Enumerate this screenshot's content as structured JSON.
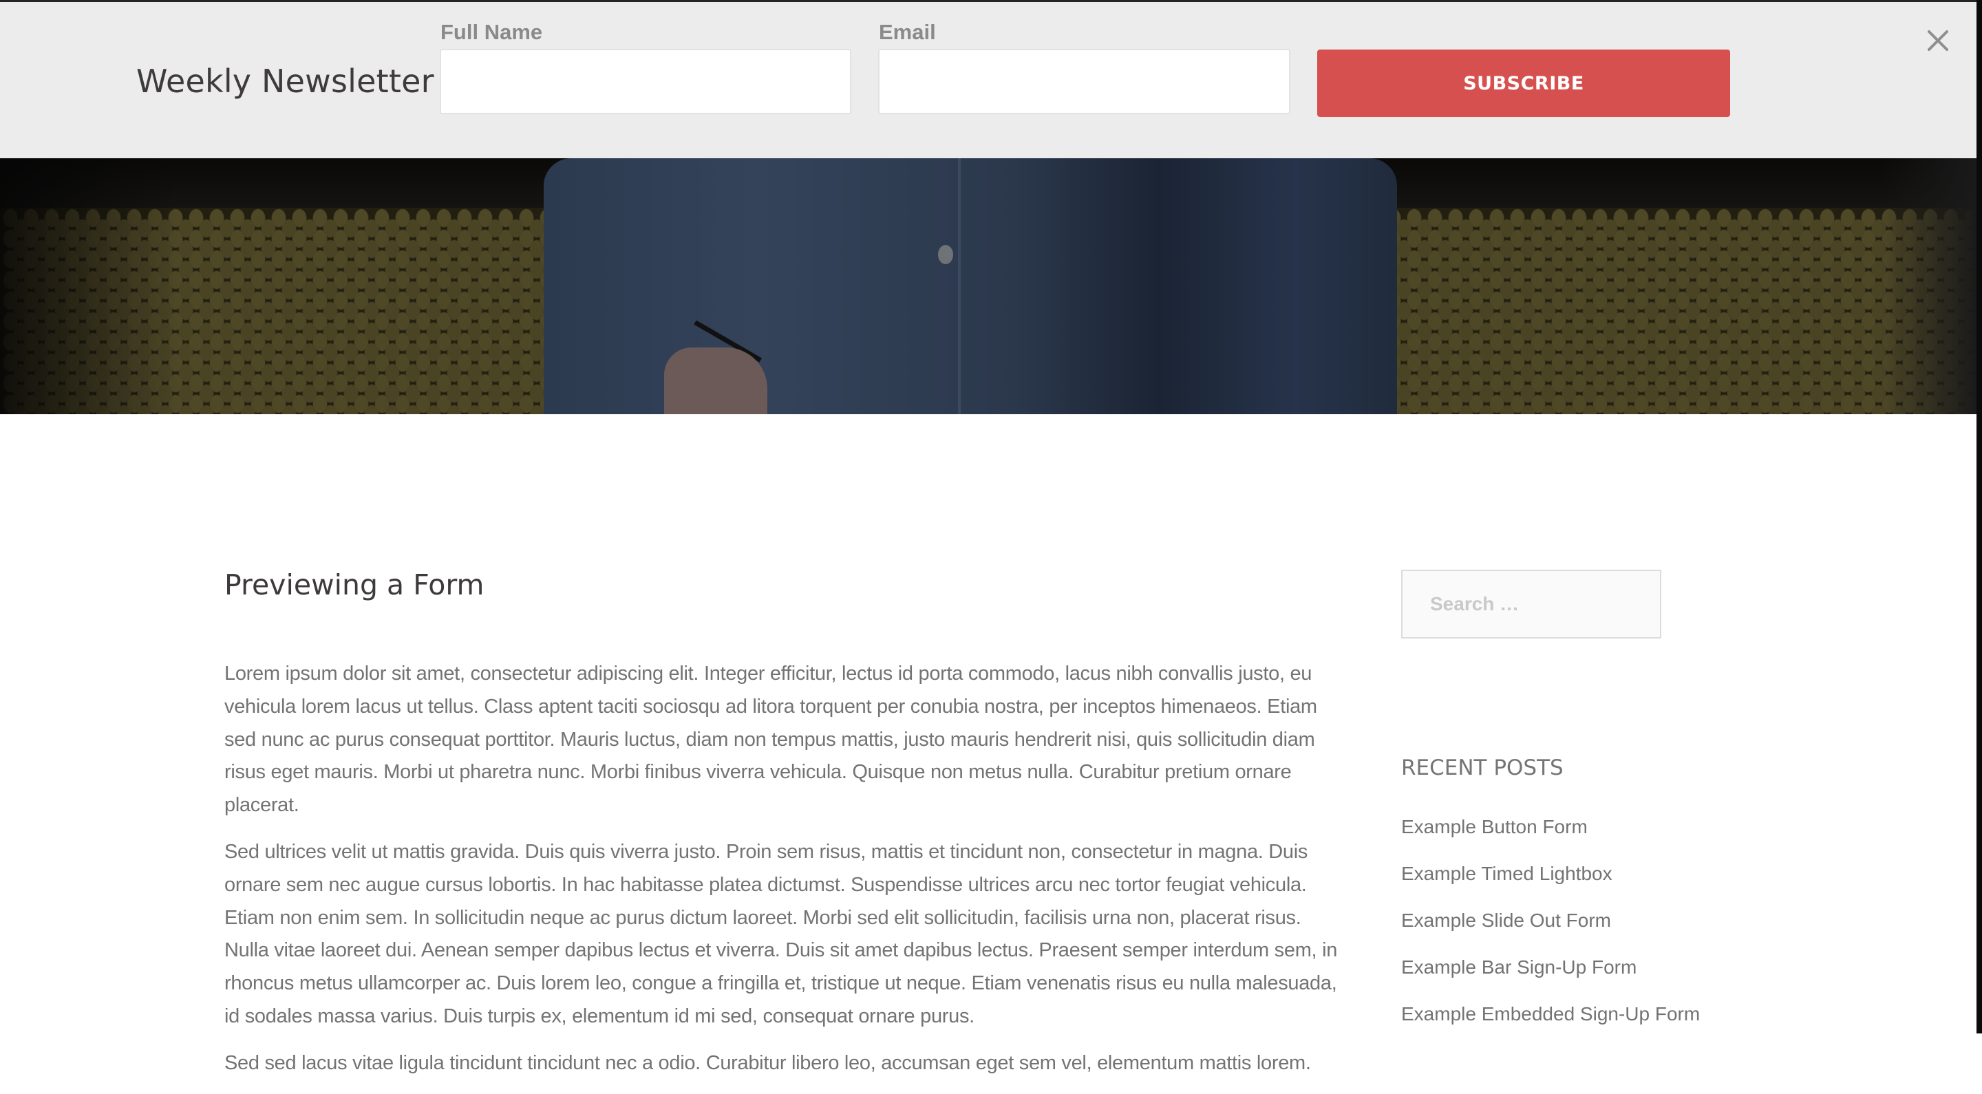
{
  "newsletter": {
    "title": "Weekly Newsletter",
    "full_name_label": "Full Name",
    "full_name_value": "",
    "email_label": "Email",
    "email_value": "",
    "subscribe_label": "SUBSCRIBE",
    "close_icon": "close-x-icon",
    "accent_color": "#d65050"
  },
  "hero": {
    "image_description": "person in denim shirt holding a pen and notebook on a patterned yellow couch"
  },
  "post": {
    "title": "Previewing a Form",
    "paragraphs": [
      "Lorem ipsum dolor sit amet, consectetur adipiscing elit. Integer efficitur, lectus id porta commodo, lacus nibh convallis justo, eu vehicula lorem lacus ut tellus. Class aptent taciti sociosqu ad litora torquent per conubia nostra, per inceptos himenaeos. Etiam sed nunc ac purus consequat porttitor. Mauris luctus, diam non tempus mattis, justo mauris hendrerit nisi, quis sollicitudin diam risus eget mauris. Morbi ut pharetra nunc. Morbi finibus viverra vehicula. Quisque non metus nulla. Curabitur pretium ornare placerat.",
      "Sed ultrices velit ut mattis gravida. Duis quis viverra justo. Proin sem risus, mattis et tincidunt non, consectetur in magna. Duis ornare sem nec augue cursus lobortis. In hac habitasse platea dictumst. Suspendisse ultrices arcu nec tortor feugiat vehicula. Etiam non enim sem. In sollicitudin neque ac purus dictum laoreet. Morbi sed elit sollicitudin, facilisis urna non, placerat risus. Nulla vitae laoreet dui. Aenean semper dapibus lectus et viverra. Duis sit amet dapibus lectus. Praesent semper interdum sem, in rhoncus metus ullamcorper ac. Duis lorem leo, congue a fringilla et, tristique ut neque. Etiam venenatis risus eu nulla malesuada, id sodales massa varius. Duis turpis ex, elementum id mi sed, consequat ornare purus.",
      "Sed sed lacus vitae ligula tincidunt tincidunt nec a odio. Curabitur libero leo, accumsan eget sem vel, elementum mattis lorem."
    ]
  },
  "sidebar": {
    "search_placeholder": "Search …",
    "search_value": "",
    "recent_posts_title": "RECENT POSTS",
    "recent_posts": [
      {
        "label": "Example Button Form"
      },
      {
        "label": "Example Timed Lightbox"
      },
      {
        "label": "Example Slide Out Form"
      },
      {
        "label": "Example Bar Sign-Up Form"
      },
      {
        "label": "Example Embedded Sign-Up Form"
      }
    ]
  }
}
